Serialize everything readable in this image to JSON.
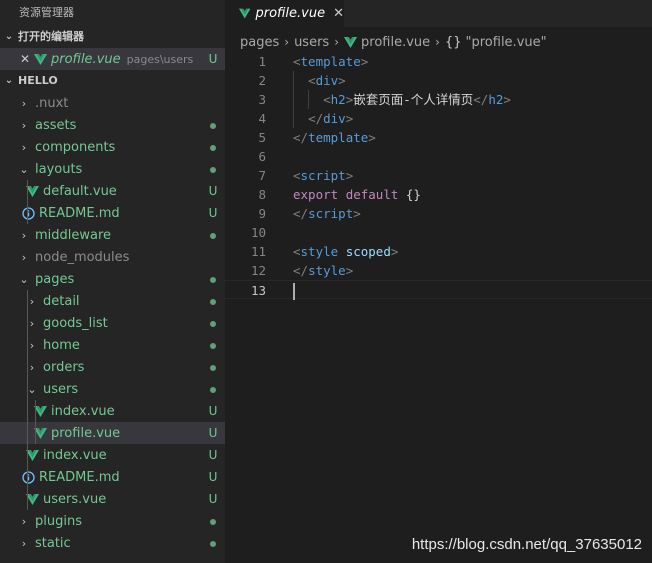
{
  "explorer": {
    "title": "资源管理器",
    "open_editors_header": "打开的编辑器",
    "open_editor": {
      "name": "profile.vue",
      "path": "pages\\users",
      "status": "U"
    },
    "workspace_header": "HELLO",
    "tree": [
      {
        "label": "nuxt_dot",
        "text": ".nuxt",
        "status": ""
      },
      {
        "text": "assets",
        "status": "dot"
      },
      {
        "text": "components",
        "status": "dot"
      },
      {
        "text": "layouts",
        "status": "dot"
      },
      {
        "text": "default.vue",
        "status": "U"
      },
      {
        "text": "README.md",
        "status": "U"
      },
      {
        "text": "middleware",
        "status": "dot"
      },
      {
        "text": "node_modules",
        "status": ""
      },
      {
        "text": "pages",
        "status": "dot"
      },
      {
        "text": "detail",
        "status": "dot"
      },
      {
        "text": "goods_list",
        "status": "dot"
      },
      {
        "text": "home",
        "status": "dot"
      },
      {
        "text": "orders",
        "status": "dot"
      },
      {
        "text": "users",
        "status": "dot"
      },
      {
        "text": "index.vue",
        "status": "U"
      },
      {
        "text": "profile.vue",
        "status": "U"
      },
      {
        "text": "index.vue",
        "status": "U"
      },
      {
        "text": "README.md",
        "status": "U"
      },
      {
        "text": "users.vue",
        "status": "U"
      },
      {
        "text": "plugins",
        "status": "dot"
      },
      {
        "text": "static",
        "status": "dot"
      }
    ]
  },
  "editor": {
    "tab": {
      "name": "profile.vue"
    },
    "breadcrumb": [
      "pages",
      "users",
      "profile.vue",
      "\"profile.vue\""
    ],
    "breadcrumb_braces": "{}",
    "line_numbers": [
      "1",
      "2",
      "3",
      "4",
      "5",
      "6",
      "7",
      "8",
      "9",
      "10",
      "11",
      "12",
      "13"
    ],
    "code": {
      "template_tag": "template",
      "div_tag": "div",
      "h2_tag": "h2",
      "h2_text": "嵌套页面-个人详情页",
      "script_tag": "script",
      "export_kw": "export",
      "default_kw": "default",
      "obj": "{}",
      "style_tag": "style",
      "scoped_attr": "scoped"
    }
  },
  "watermark": "https://blog.csdn.net/qq_37635012",
  "colors": {
    "vue_icon": "#41b883",
    "untracked": "#73c991",
    "info_icon": "#75beff"
  }
}
